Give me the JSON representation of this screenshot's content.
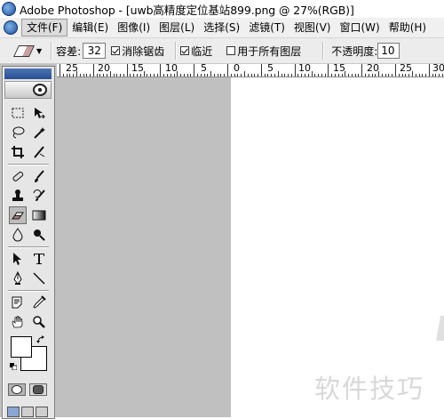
{
  "title": "Adobe Photoshop - [uwb高精度定位基站899.png @ 27%(RGB)]",
  "menu": {
    "items": [
      {
        "label": "文件(F)",
        "active": true
      },
      {
        "label": "编辑(E)",
        "active": false
      },
      {
        "label": "图像(I)",
        "active": false
      },
      {
        "label": "图层(L)",
        "active": false
      },
      {
        "label": "选择(S)",
        "active": false
      },
      {
        "label": "滤镜(T)",
        "active": false
      },
      {
        "label": "视图(V)",
        "active": false
      },
      {
        "label": "窗口(W)",
        "active": false
      },
      {
        "label": "帮助(H)",
        "active": false
      }
    ]
  },
  "options": {
    "tool_icon": "magic-eraser-icon",
    "tolerance_label": "容差:",
    "tolerance_value": "32",
    "antialias_label": "消除锯齿",
    "antialias_checked": true,
    "contiguous_label": "临近",
    "contiguous_checked": true,
    "all_layers_label": "用于所有图层",
    "all_layers_checked": false,
    "opacity_label": "不透明度:",
    "opacity_value": "10"
  },
  "ruler": {
    "labels": [
      "25",
      "20",
      "15",
      "10",
      "5",
      "0",
      "5",
      "10",
      "15",
      "20",
      "25",
      "30"
    ]
  },
  "watermark": "软件技巧",
  "toolbox": {
    "tools": [
      {
        "name": "marquee-icon",
        "glyph": "⬚"
      },
      {
        "name": "move-icon",
        "glyph": "✥"
      },
      {
        "name": "lasso-icon",
        "glyph": "ℓ"
      },
      {
        "name": "magic-wand-icon",
        "glyph": "✧"
      },
      {
        "name": "crop-icon",
        "glyph": "⌗"
      },
      {
        "name": "slice-icon",
        "glyph": "⟋"
      },
      {
        "name": "healing-brush-icon",
        "glyph": "✎"
      },
      {
        "name": "brush-icon",
        "glyph": "∕"
      },
      {
        "name": "clone-stamp-icon",
        "glyph": "♙"
      },
      {
        "name": "history-brush-icon",
        "glyph": "↺"
      },
      {
        "name": "eraser-icon",
        "glyph": "⌫"
      },
      {
        "name": "gradient-icon",
        "glyph": "■"
      },
      {
        "name": "blur-icon",
        "glyph": "💧"
      },
      {
        "name": "dodge-icon",
        "glyph": "●"
      },
      {
        "name": "path-selection-icon",
        "glyph": "➤"
      },
      {
        "name": "type-icon",
        "glyph": "T"
      },
      {
        "name": "pen-icon",
        "glyph": "✒"
      },
      {
        "name": "line-icon",
        "glyph": "╲"
      },
      {
        "name": "notes-icon",
        "glyph": "▤"
      },
      {
        "name": "eyedropper-icon",
        "glyph": "⁄"
      },
      {
        "name": "hand-icon",
        "glyph": "✋"
      },
      {
        "name": "zoom-icon",
        "glyph": "🔍"
      }
    ],
    "selected_tool": "eraser-icon"
  }
}
